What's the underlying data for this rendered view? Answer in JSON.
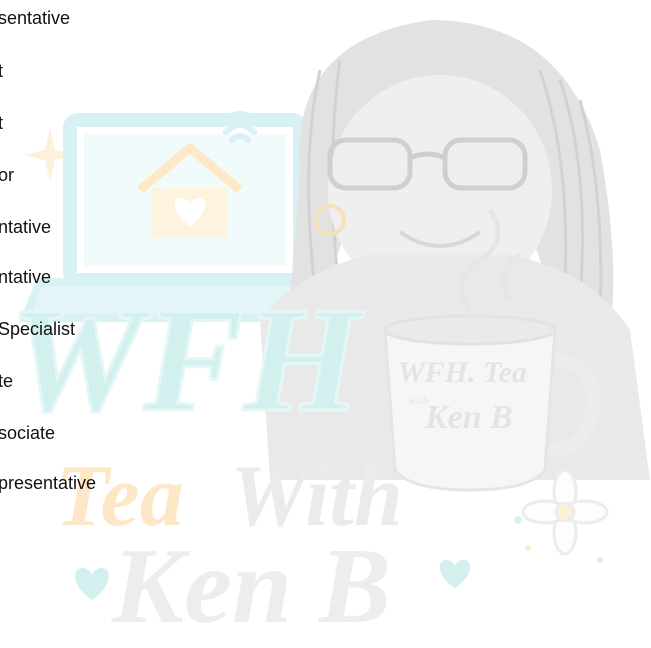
{
  "job_list": {
    "items": [
      "sentative",
      "t",
      "t",
      "or",
      "ntative",
      "ntative",
      " Specialist",
      "te",
      "sociate",
      "presentative"
    ]
  },
  "watermark": {
    "line1": "WFH",
    "line2a": "Tea",
    "line2b": "With",
    "line3": "Ken B",
    "mug_text_1": "WFH. Tea",
    "mug_text_2": "with",
    "mug_text_3": "Ken B",
    "colors": {
      "wfh": "#cfeeed",
      "tea": "#fde8c8",
      "with": "#ececec",
      "ken": "#f0f0f0",
      "heart": "#d5f1ef",
      "laptop": "#d8f2f5",
      "house": "#fdebc5",
      "hair": "#d8d8d8",
      "skin": "#eeeeee",
      "mug": "#f7f7f7"
    },
    "icons": [
      "laptop-icon",
      "house-icon",
      "wifi-icon",
      "sparkle-icon",
      "heart-icon",
      "flower-icon",
      "coffee-mug-icon"
    ]
  }
}
